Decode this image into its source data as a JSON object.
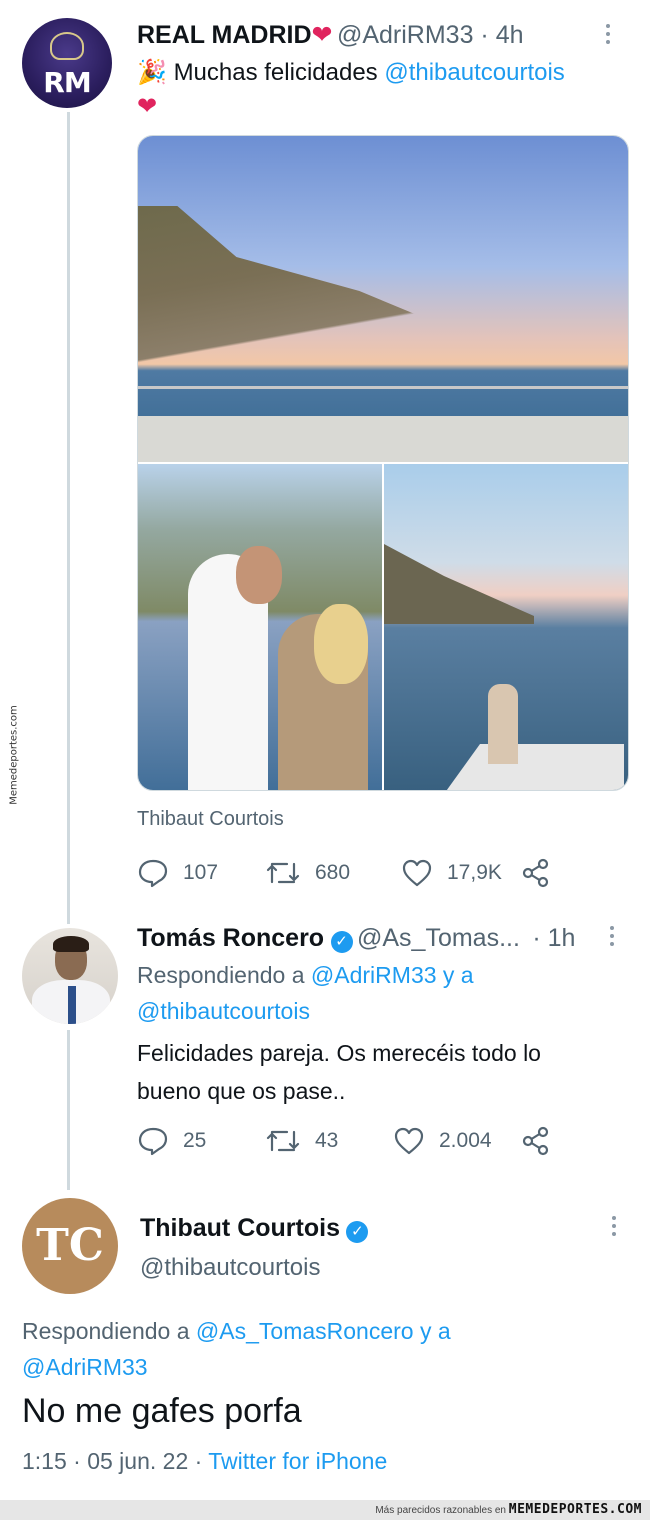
{
  "tweet1": {
    "name": "REAL MADRID",
    "heart": "❤",
    "handle_time": "@AdriRM33 · 4h",
    "party_emoji": "🎉",
    "text_before": "Muchas felicidades ",
    "mention": "@thibautcourtois",
    "heart_line": "❤",
    "media_tag": "Thibaut Courtois",
    "stats": {
      "replies": "107",
      "retweets": "680",
      "likes": "17,9K"
    }
  },
  "tweet2": {
    "name": "Tomás Roncero",
    "verified_mark": "✓",
    "handle": "@As_Tomas...",
    "time": "· 1h",
    "replying_prefix": "Respondiendo a ",
    "replying_mention1": "@AdriRM33 y a",
    "replying_mention2": "@thibautcourtois",
    "text_line1": "Felicidades pareja. Os merecéis todo lo",
    "text_line2": "bueno que os pase..",
    "stats": {
      "replies": "25",
      "retweets": "43",
      "likes": "2.004"
    }
  },
  "tweet3": {
    "name": "Thibaut Courtois",
    "verified_mark": "✓",
    "handle": "@thibautcourtois",
    "avatar_monogram": "TC",
    "replying_prefix": "Respondiendo a ",
    "replying_mention1": "@As_TomasRoncero y a",
    "replying_mention2": "@AdriRM33",
    "text": "No me gafes porfa",
    "meta_time": "1:15 · 05 jun. 22 · ",
    "meta_source": "Twitter for iPhone"
  },
  "avatar_rm_text": "RM",
  "side_watermark": "Memedeportes.com",
  "footer": {
    "prefix": "Más parecidos razonables en ",
    "brand": "MEMEDEPORTES.COM"
  },
  "colors": {
    "link": "#1d9bf0",
    "muted": "#536471",
    "heart": "#e0245e",
    "thread_line": "#cfd9de"
  }
}
